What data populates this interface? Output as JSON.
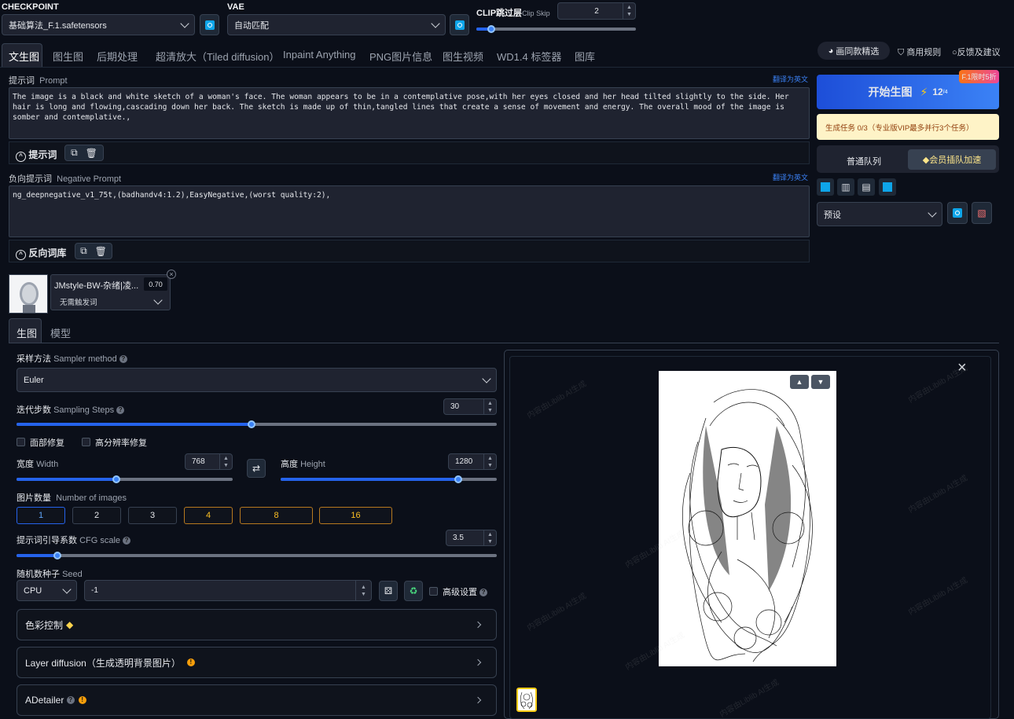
{
  "header": {
    "checkpoint_label": "CHECKPOINT",
    "checkpoint_value": "基础算法_F.1.safetensors",
    "vae_label": "VAE",
    "vae_value": "自动匹配",
    "clip_label": "CLIP跳过层",
    "clip_sub": "Clip Skip",
    "clip_value": "2",
    "clip_fraction": 0.1
  },
  "tabs": [
    "文生图",
    "图生图",
    "后期处理",
    "超清放大（Tiled diffusion）",
    "Inpaint Anything",
    "PNG图片信息",
    "图生视频",
    "WD1.4 标签器",
    "图库"
  ],
  "top_links": {
    "featured": "画同款精选",
    "rules": "商用规则",
    "feedback": "反馈及建议"
  },
  "prompt": {
    "label": "提示词",
    "sub": "Prompt",
    "translate": "翻译为英文",
    "text": "The image is a black and white sketch of a woman's face. The woman appears to be in a contemplative pose,with her eyes closed and her head tilted slightly to the side. Her hair is long and flowing,cascading down her back. The sketch is made up of thin,tangled lines that create a sense of movement and energy. The overall mood of the image is somber and contemplative.,",
    "lib_label": "提示词"
  },
  "neg": {
    "label": "负向提示词",
    "sub": "Negative Prompt",
    "translate": "翻译为英文",
    "text": "ng_deepnegative_v1_75t,(badhandv4:1.2),EasyNegative,(worst quality:2),",
    "lib_label": "反向词库"
  },
  "lora": {
    "name": "JMstyle-BW-杂绪|凌...",
    "weight": "0.70",
    "trigger": "无需触发词"
  },
  "right": {
    "generate": "开始生图",
    "cost": "12",
    "cost_sub": "/4",
    "promo": "F.1限时5折",
    "task_info": "生成任务 0/3（专业版VIP最多并行3个任务）",
    "queue_normal": "普通队列",
    "queue_vip": "会员插队加速",
    "preset": "预设"
  },
  "subtabs": [
    "生图",
    "模型"
  ],
  "sampler": {
    "label": "采样方法",
    "sub": "Sampler method",
    "value": "Euler"
  },
  "steps": {
    "label": "迭代步数",
    "sub": "Sampling Steps",
    "value": "30",
    "fraction": 0.49
  },
  "checks": {
    "face": "面部修复",
    "hires": "高分辨率修复"
  },
  "width": {
    "label": "宽度",
    "sub": "Width",
    "value": "768",
    "fraction": 0.46
  },
  "height": {
    "label": "高度",
    "sub": "Height",
    "value": "1280",
    "fraction": 0.82
  },
  "batch": {
    "label": "图片数量",
    "sub": "Number of images",
    "options": [
      "1",
      "2",
      "3",
      "4",
      "8",
      "16"
    ]
  },
  "cfg": {
    "label": "提示词引导系数",
    "sub": "CFG scale",
    "value": "3.5",
    "fraction": 0.085
  },
  "seed": {
    "label": "随机数种子",
    "sub": "Seed",
    "device": "CPU",
    "value": "-1",
    "advanced": "高级设置"
  },
  "panels": {
    "color": "色彩控制",
    "layer": "Layer diffusion（生成透明背景图片）",
    "adetailer": "ADetailer"
  },
  "watermark": "内容由Liblib AI生成",
  "colors": {
    "accent": "#2563eb",
    "gold": "#f59e0b"
  }
}
